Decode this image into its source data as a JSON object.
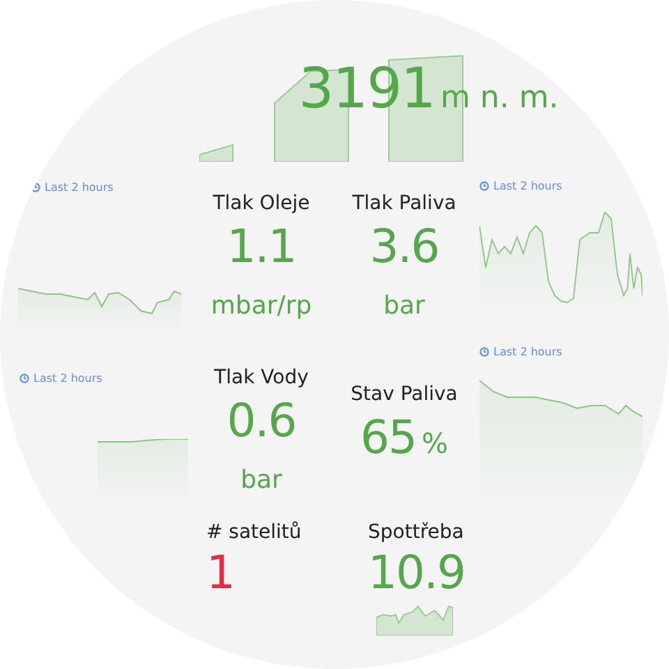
{
  "panels": [
    {
      "kind": "stat",
      "value": "3191",
      "unit": "m n. m.",
      "color": "#56a64b"
    },
    {
      "kind": "timeseries",
      "time_range": "Last 2 hours"
    },
    {
      "kind": "stat",
      "title": "Tlak Oleje",
      "value": "1.1",
      "unit": "mbar/rp",
      "color": "#56a64b"
    },
    {
      "kind": "stat",
      "title": "Tlak Paliva",
      "value": "3.6",
      "unit": "bar",
      "color": "#56a64b"
    },
    {
      "kind": "timeseries",
      "time_range": "Last 2 hours"
    },
    {
      "kind": "timeseries",
      "time_range": "Last 2 hours"
    },
    {
      "kind": "timeseries",
      "time_range": "Last 2 hours"
    },
    {
      "kind": "stat",
      "title": "Tlak Vody",
      "value": "0.6",
      "unit": "bar",
      "color": "#56a64b"
    },
    {
      "kind": "stat",
      "title": "Stav Paliva",
      "value": "65",
      "unit": "%",
      "color": "#56a64b"
    },
    {
      "kind": "stat",
      "title": "# satelitů",
      "value": "1",
      "color": "#e02f44"
    },
    {
      "kind": "stat",
      "title": "Spottřeba",
      "value": "10.9",
      "color": "#56a64b"
    }
  ]
}
